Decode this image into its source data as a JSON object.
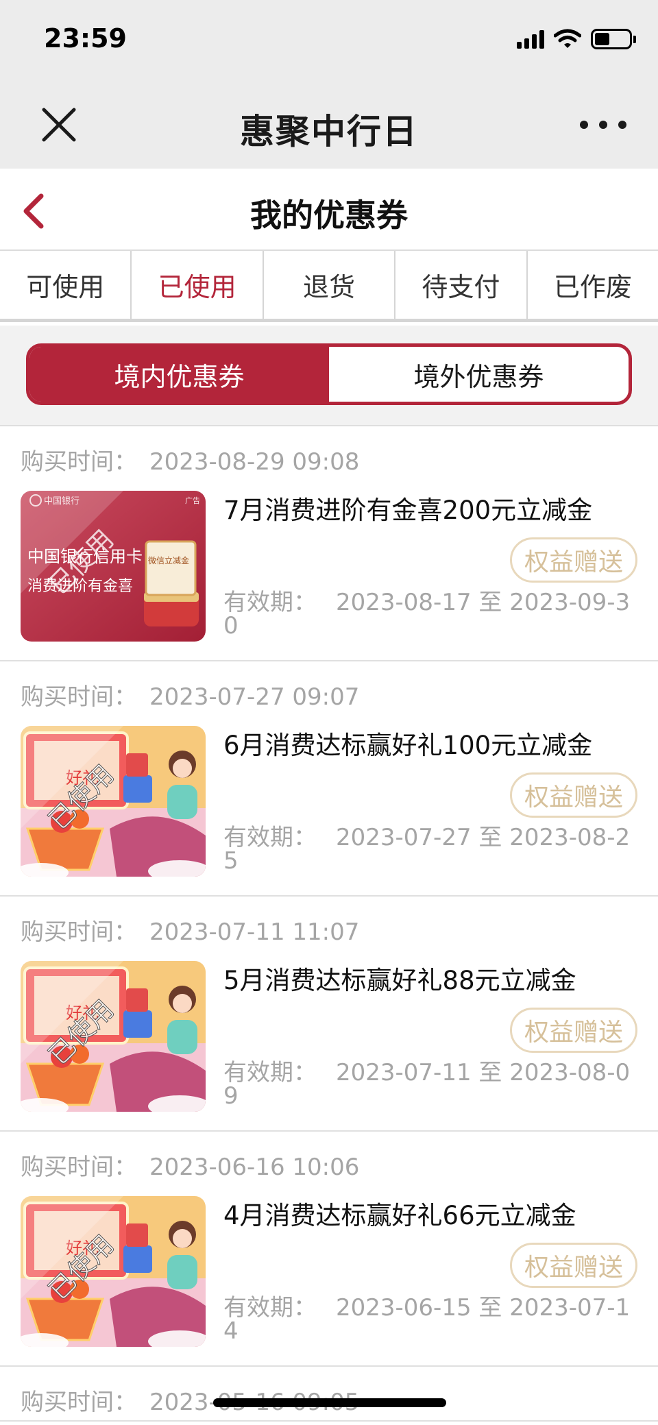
{
  "status_bar": {
    "time": "23:59"
  },
  "mini_program": {
    "title": "惠聚中行日"
  },
  "page": {
    "title": "我的优惠券"
  },
  "status_tabs": [
    {
      "label": "可使用"
    },
    {
      "label": "已使用",
      "active": true
    },
    {
      "label": "退货"
    },
    {
      "label": "待支付"
    },
    {
      "label": "已作废"
    }
  ],
  "region_tabs": [
    {
      "label": "境内优惠券",
      "active": true
    },
    {
      "label": "境外优惠券"
    }
  ],
  "labels": {
    "purchase_time": "购买时间：",
    "validity": "有效期：",
    "to": "至",
    "gift_button": "权益赠送",
    "used_stamp": "已使用"
  },
  "coupons": [
    {
      "purchase_time": "2023-08-29 09:08",
      "name": "7月消费进阶有金喜200元立减金",
      "valid_from": "2023-08-17",
      "valid_to": "2023-09-30",
      "thumb": "boc-card",
      "thumb_text": {
        "bank": "中国银行信用卡",
        "slogan": "消费进阶有金喜",
        "ad": "广告",
        "box": "微信立减金"
      }
    },
    {
      "purchase_time": "2023-07-27 09:07",
      "name": "6月消费达标赢好礼100元立减金",
      "valid_from": "2023-07-27",
      "valid_to": "2023-08-25",
      "thumb": "shopping"
    },
    {
      "purchase_time": "2023-07-11 11:07",
      "name": "5月消费达标赢好礼88元立减金",
      "valid_from": "2023-07-11",
      "valid_to": "2023-08-09",
      "thumb": "shopping"
    },
    {
      "purchase_time": "2023-06-16 10:06",
      "name": "4月消费达标赢好礼66元立减金",
      "valid_from": "2023-06-15",
      "valid_to": "2023-07-14",
      "thumb": "shopping"
    }
  ],
  "partial_row": {
    "purchase_time": "2023-05-16 09:05"
  },
  "colors": {
    "accent": "#b3253a",
    "gift_border": "#e8d8bc",
    "gift_text": "#d6c09a",
    "muted": "#a5a5a5"
  },
  "icons": [
    "close-icon",
    "more-icon",
    "back-chevron-icon",
    "signal-icon",
    "wifi-icon",
    "battery-icon"
  ]
}
